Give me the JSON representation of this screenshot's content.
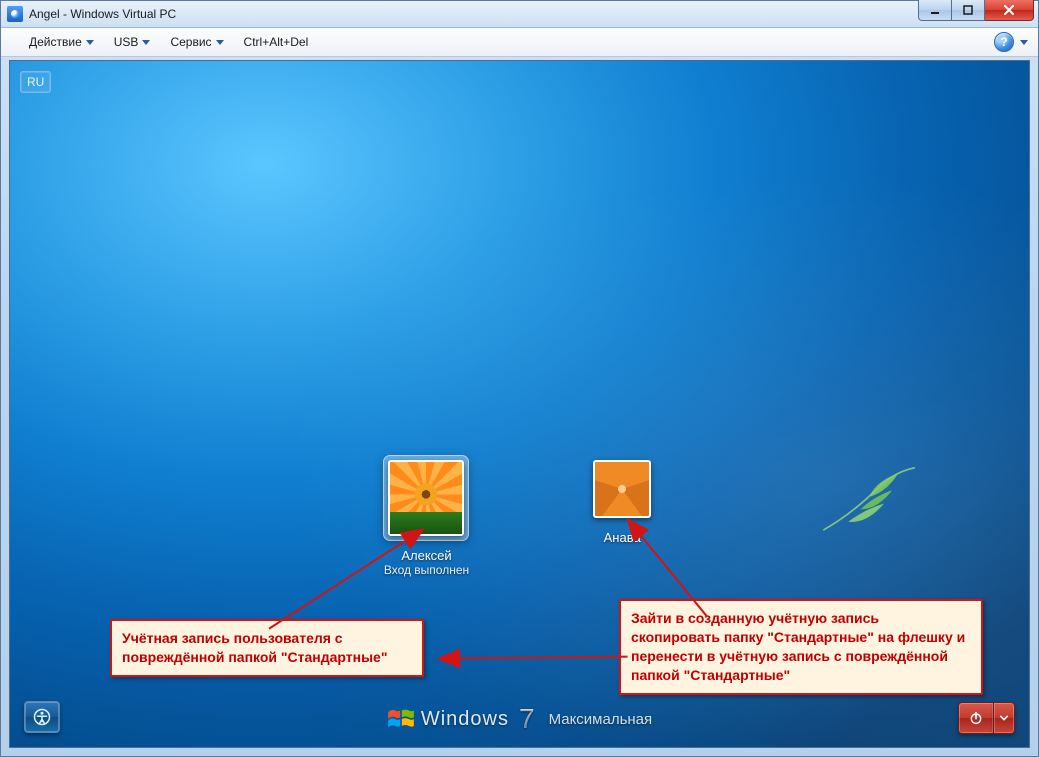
{
  "window": {
    "title": "Angel - Windows Virtual PC"
  },
  "menu": {
    "action": "Действие",
    "usb": "USB",
    "service": "Сервис",
    "cad": "Ctrl+Alt+Del"
  },
  "login": {
    "lang": "RU",
    "users": [
      {
        "name": "Алексей",
        "status": "Вход выполнен"
      },
      {
        "name": "Анава",
        "status": ""
      }
    ],
    "brand_name": "Windows",
    "brand_num": "7",
    "brand_edition": "Максимальная"
  },
  "annotations": {
    "left": "Учётная запись пользователя с повреждённой папкой \"Стандартные\"",
    "right": "Зайти в созданную учётную запись скопировать папку \"Стандартные\" на флешку  и перенести в учётную запись с повреждённой папкой \"Стандартные\""
  }
}
